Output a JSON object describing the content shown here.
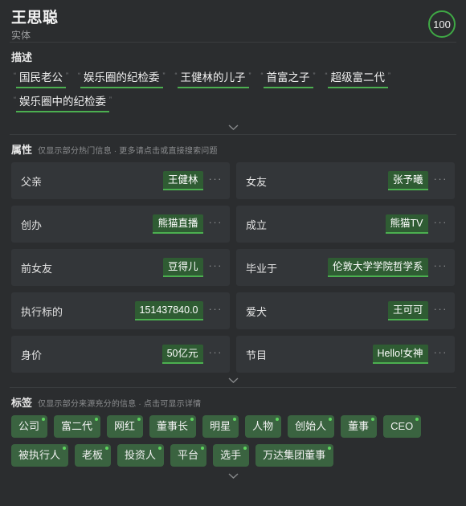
{
  "header": {
    "title": "王思聪",
    "subtitle": "实体",
    "score": "100",
    "score_color": "#3fa845"
  },
  "description": {
    "section_title": "描述",
    "quote_open": "“",
    "quote_close": "”",
    "items": [
      {
        "text": "国民老公"
      },
      {
        "text": "娱乐圈的纪检委"
      },
      {
        "text": "王健林的儿子"
      },
      {
        "text": "首富之子"
      },
      {
        "text": "超级富二代"
      },
      {
        "text": "娱乐圈中的纪检委"
      }
    ],
    "expand_icon": "chevron-down-icon"
  },
  "attributes": {
    "section_title": "属性",
    "hint": "仅显示部分热门信息 · 更多请点击或直接搜索问题",
    "more_label": "···",
    "items": [
      {
        "label": "父亲",
        "value": "王健林"
      },
      {
        "label": "女友",
        "value": "张予曦"
      },
      {
        "label": "创办",
        "value": "熊猫直播"
      },
      {
        "label": "成立",
        "value": "熊猫TV"
      },
      {
        "label": "前女友",
        "value": "豆得儿"
      },
      {
        "label": "毕业于",
        "value": "伦敦大学学院哲学系"
      },
      {
        "label": "执行标的",
        "value": "151437840.0"
      },
      {
        "label": "爱犬",
        "value": "王可可"
      },
      {
        "label": "身价",
        "value": "50亿元"
      },
      {
        "label": "节目",
        "value": "Hello!女神"
      }
    ],
    "expand_icon": "chevron-down-icon"
  },
  "tags": {
    "section_title": "标签",
    "hint": "仅显示部分来源充分的信息 · 点击可显示详情",
    "items": [
      {
        "label": "公司"
      },
      {
        "label": "富二代"
      },
      {
        "label": "网红"
      },
      {
        "label": "董事长"
      },
      {
        "label": "明星"
      },
      {
        "label": "人物"
      },
      {
        "label": "创始人"
      },
      {
        "label": "董事"
      },
      {
        "label": "CEO"
      },
      {
        "label": "被执行人"
      },
      {
        "label": "老板"
      },
      {
        "label": "投资人"
      },
      {
        "label": "平台"
      },
      {
        "label": "选手"
      },
      {
        "label": "万达集团董事"
      }
    ],
    "expand_icon": "chevron-down-icon"
  },
  "theme": {
    "background": "#2b2d2f",
    "card": "#333639",
    "accent_green": "#4caf50",
    "chip_green": "#2f5c33",
    "tag_green": "#3a6340"
  }
}
